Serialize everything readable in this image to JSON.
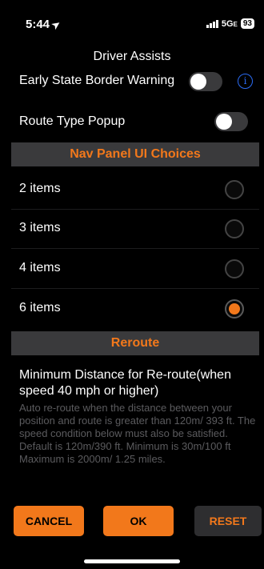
{
  "status_bar": {
    "time": "5:44",
    "network": "5G",
    "network_suffix": "E",
    "battery": "93"
  },
  "dialog": {
    "title": "Driver Assists",
    "early_state_border_warning": {
      "label": "Early State Border Warning",
      "on": false
    },
    "route_type_popup": {
      "label": "Route Type Popup",
      "on": false
    },
    "nav_panel_header": "Nav Panel UI Choices",
    "nav_panel_options": [
      {
        "label": "2 items",
        "selected": false
      },
      {
        "label": "3 items",
        "selected": false
      },
      {
        "label": "4 items",
        "selected": false
      },
      {
        "label": "6 items",
        "selected": true
      }
    ],
    "reroute_header": "Reroute",
    "reroute_title": "Minimum Distance for Re-route(when speed 40 mph or higher)",
    "reroute_description": "Auto re-route when the distance between your position and route is greater than 120m/ 393 ft. The speed condition below must also be satisfied. Default is 120m/390 ft. Minimum is 30m/100 ft Maximum is 2000m/ 1.25 miles."
  },
  "buttons": {
    "cancel": "CANCEL",
    "ok": "OK",
    "reset": "RESET"
  },
  "colors": {
    "accent": "#f2781b",
    "info_blue": "#2b6cf5",
    "section_bg": "#3a3a3c"
  }
}
